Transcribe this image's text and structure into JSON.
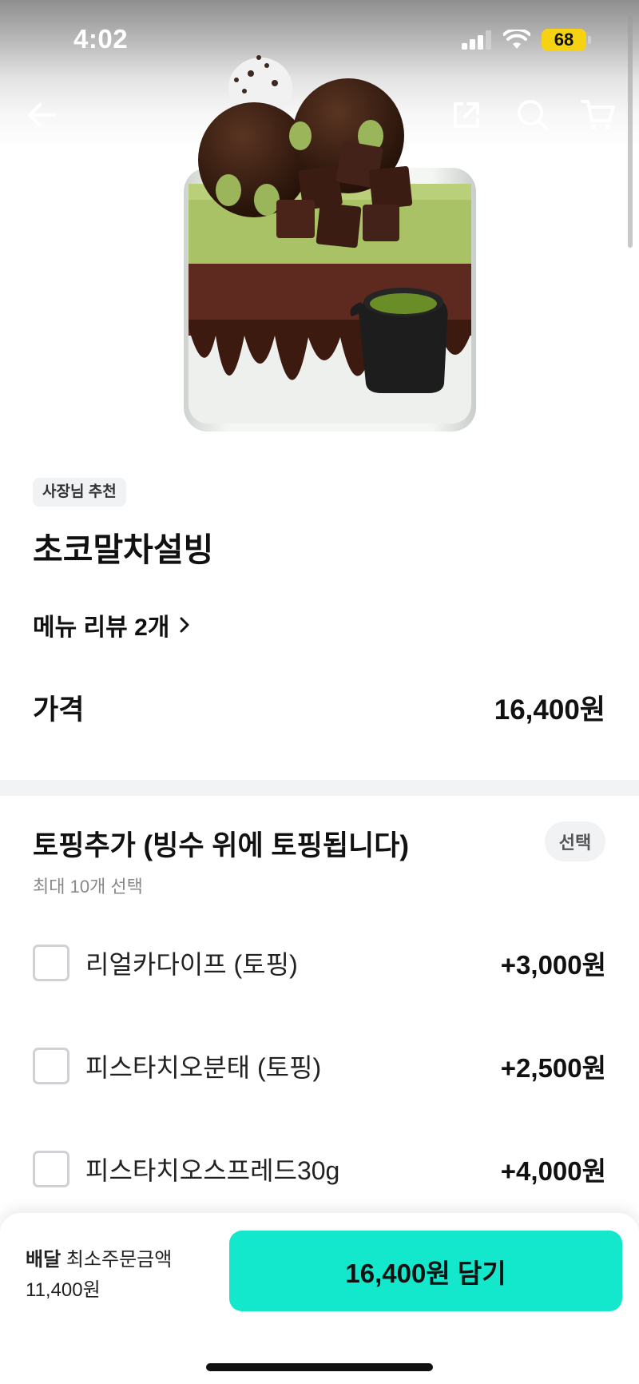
{
  "status_bar": {
    "time": "4:02",
    "battery": "68"
  },
  "nav": {
    "back": "arrow-left-icon",
    "share": "share-icon",
    "search": "search-icon",
    "cart": "cart-icon"
  },
  "product": {
    "badge": "사장님 추천",
    "name": "초코말차설빙",
    "review_link": "메뉴 리뷰 2개",
    "price_label": "가격",
    "price_value": "16,400원"
  },
  "option_group": {
    "title": "토핑추가 (빙수 위에 토핑됩니다)",
    "tag": "선택",
    "subtitle": "최대 10개 선택",
    "items": [
      {
        "name": "리얼카다이프 (토핑)",
        "price": "+3,000원",
        "checked": false
      },
      {
        "name": "피스타치오분태 (토핑)",
        "price": "+2,500원",
        "checked": false
      },
      {
        "name": "피스타치오스프레드30g",
        "price": "+4,000원",
        "checked": false
      }
    ]
  },
  "bottom_bar": {
    "delivery_label": "배달",
    "min_order_label": "최소주문금액",
    "min_order_value": "11,400원",
    "cta_label": "16,400원 담기"
  },
  "colors": {
    "accent": "#13e8cc",
    "battery": "#f5d312"
  }
}
